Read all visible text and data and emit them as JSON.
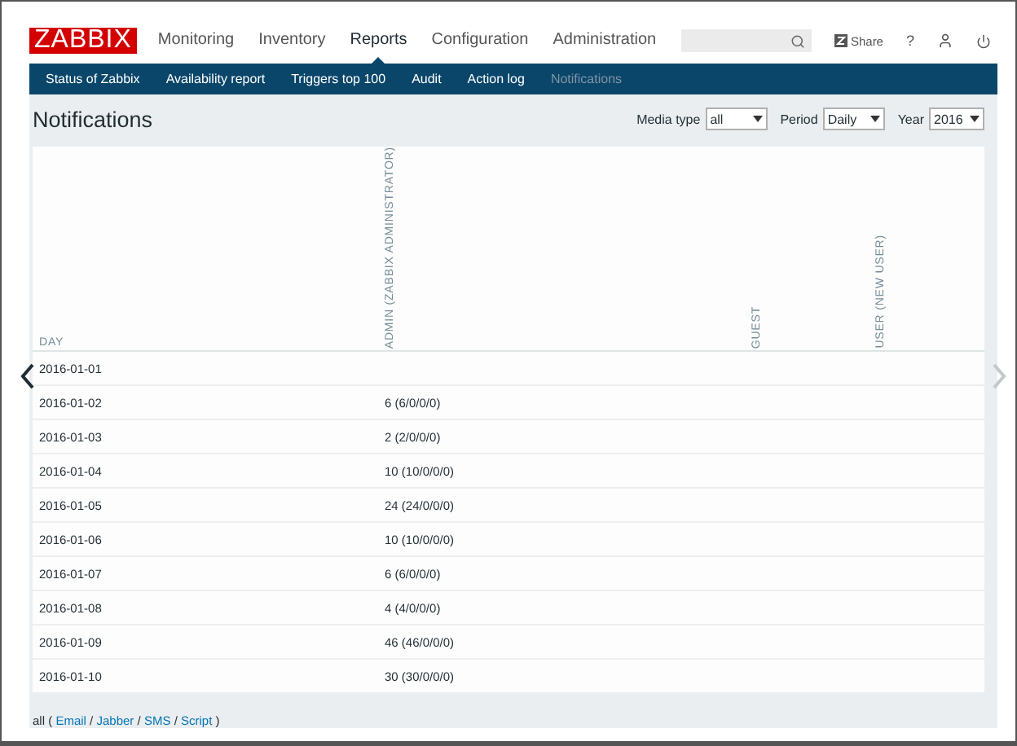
{
  "logo": "ZABBIX",
  "menu": [
    {
      "label": "Monitoring",
      "selected": false
    },
    {
      "label": "Inventory",
      "selected": false
    },
    {
      "label": "Reports",
      "selected": true
    },
    {
      "label": "Configuration",
      "selected": false
    },
    {
      "label": "Administration",
      "selected": false
    }
  ],
  "header_actions": {
    "share": "Share",
    "help": "?"
  },
  "submenu": [
    {
      "label": "Status of Zabbix",
      "selected": false
    },
    {
      "label": "Availability report",
      "selected": false
    },
    {
      "label": "Triggers top 100",
      "selected": false
    },
    {
      "label": "Audit",
      "selected": false
    },
    {
      "label": "Action log",
      "selected": false
    },
    {
      "label": "Notifications",
      "selected": true
    }
  ],
  "page_title": "Notifications",
  "filters": [
    {
      "label": "Media type",
      "value": "all"
    },
    {
      "label": "Period",
      "value": "Daily"
    },
    {
      "label": "Year",
      "value": "2016"
    }
  ],
  "table": {
    "columns": [
      "DAY",
      "ADMIN (ZABBIX ADMINISTRATOR)",
      "GUEST",
      "USER (NEW USER)"
    ],
    "rows": [
      [
        "2016-01-01",
        "",
        "",
        ""
      ],
      [
        "2016-01-02",
        "6 (6/0/0/0)",
        "",
        ""
      ],
      [
        "2016-01-03",
        "2 (2/0/0/0)",
        "",
        ""
      ],
      [
        "2016-01-04",
        "10 (10/0/0/0)",
        "",
        ""
      ],
      [
        "2016-01-05",
        "24 (24/0/0/0)",
        "",
        ""
      ],
      [
        "2016-01-06",
        "10 (10/0/0/0)",
        "",
        ""
      ],
      [
        "2016-01-07",
        "6 (6/0/0/0)",
        "",
        ""
      ],
      [
        "2016-01-08",
        "4 (4/0/0/0)",
        "",
        ""
      ],
      [
        "2016-01-09",
        "46 (46/0/0/0)",
        "",
        ""
      ],
      [
        "2016-01-10",
        "30 (30/0/0/0)",
        "",
        ""
      ]
    ]
  },
  "pager": {
    "previous_disabled": false,
    "next_disabled": true
  },
  "legend": [
    {
      "kind": "text",
      "text": "all ("
    },
    {
      "kind": "link",
      "text": "Email"
    },
    {
      "kind": "text",
      "text": "/"
    },
    {
      "kind": "link",
      "text": "Jabber"
    },
    {
      "kind": "text",
      "text": "/"
    },
    {
      "kind": "link",
      "text": "SMS"
    },
    {
      "kind": "text",
      "text": "/"
    },
    {
      "kind": "link",
      "text": "Script"
    },
    {
      "kind": "text",
      "text": ")"
    }
  ]
}
